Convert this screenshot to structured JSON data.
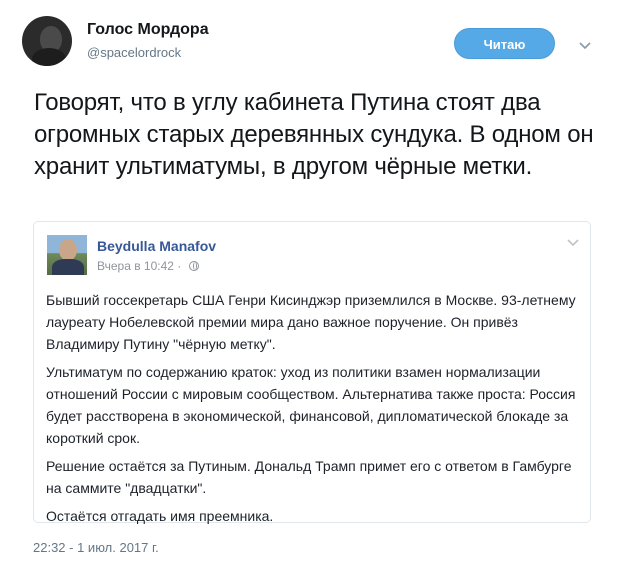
{
  "author": {
    "name": "Голос Мордора",
    "handle": "@spacelordrock",
    "follow_label": "Читаю"
  },
  "tweet": {
    "text": "Говорят, что в углу кабинета Путина стоят два огромных старых деревянных сундука. В одном он хранит ультиматумы, в другом чёрные метки.",
    "timestamp": "22:32 - 1 июл. 2017 г."
  },
  "embedded_post": {
    "author_name": "Beydulla Manafov",
    "time": "Вчера в 10:42 ·",
    "paragraphs": [
      "Бывший госсекретарь США Генри Кисинджэр приземлился в Москве. 93-летнему лауреату Нобелевской премии мира дано важное поручение. Он привёз Владимиру Путину \"чёрную метку\".",
      "Ультиматум по содержанию краток: уход из политики взамен нормализации отношений России с мировым сообществом. Альтернатива также проста: Россия будет расстворена в экономической, финансовой, дипломатической блокаде за короткий срок.",
      "Решение остаётся за Путиным. Дональд Трамп примет его с ответом в Гамбурге на саммите \"двадцатки\".",
      "Остаётся отгадать имя преемника."
    ]
  },
  "icons": {
    "caret": "chevron-down-icon",
    "globe": "globe-icon"
  },
  "colors": {
    "follow_button": "#55a9e6",
    "facebook_name": "#365899"
  }
}
